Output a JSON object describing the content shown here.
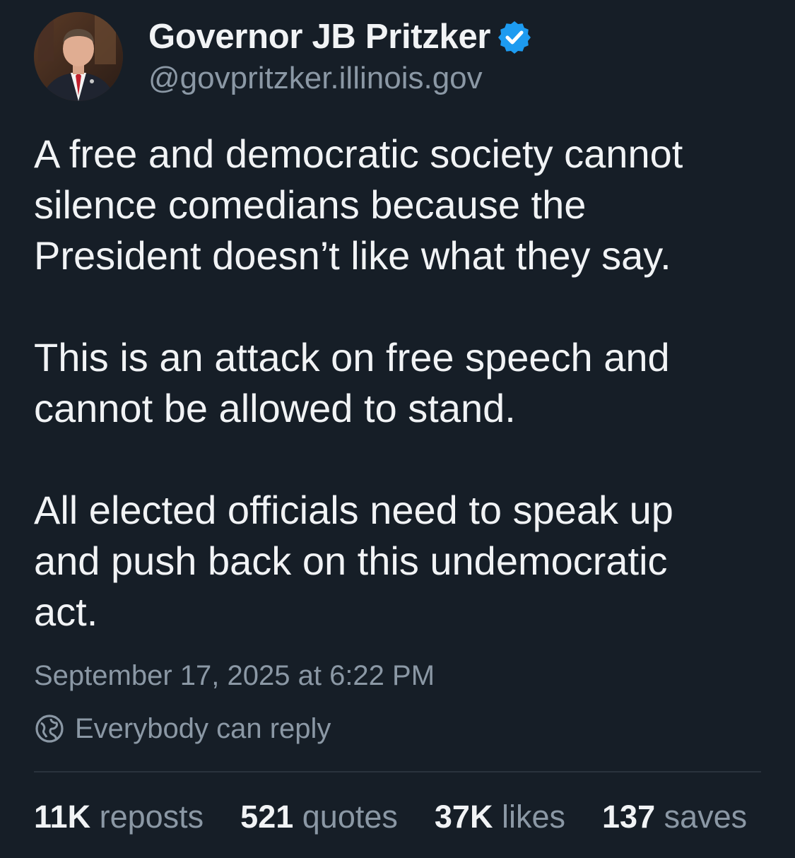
{
  "author": {
    "display_name": "Governor JB Pritzker",
    "handle": "@govpritzker.illinois.gov",
    "verified_icon": "verified-badge-icon",
    "verified_color": "#1d9bf0"
  },
  "post": {
    "paragraphs": [
      "A free and democratic society cannot\nsilence comedians because the\nPresident doesn’t like what they say.",
      "This is an attack on free speech and\ncannot be allowed to stand.",
      "All elected officials need to speak up\nand push back on this undemocratic\nact."
    ],
    "timestamp": "September 17, 2025 at 6:22 PM",
    "reply_setting": "Everybody can reply",
    "reply_icon": "globe-icon"
  },
  "stats": [
    {
      "count": "11K",
      "label": "reposts"
    },
    {
      "count": "521",
      "label": "quotes"
    },
    {
      "count": "37K",
      "label": "likes"
    },
    {
      "count": "137",
      "label": "saves"
    }
  ],
  "colors": {
    "background": "#161e27",
    "primary_text": "#f1f3f5",
    "secondary_text": "#8b98a5",
    "divider": "#2a333d",
    "accent": "#1d9bf0"
  }
}
